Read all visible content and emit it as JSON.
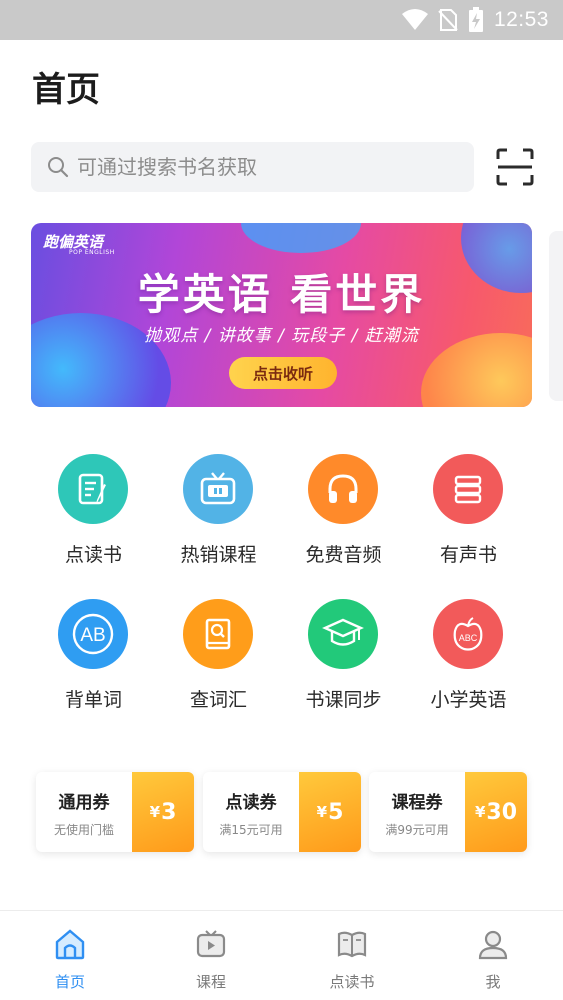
{
  "status_bar": {
    "time": "12:53",
    "icons": [
      "wifi-icon",
      "no-sim-icon",
      "battery-charging-icon"
    ]
  },
  "header": {
    "title": "首页"
  },
  "search": {
    "placeholder": "可通过搜索书名获取",
    "scan_icon": "scan-icon"
  },
  "banner": {
    "logo": "跑偏英语",
    "logo_sub": "POP ENGLISH",
    "headline": "学英语 看世界",
    "subline": "抛观点 / 讲故事 / 玩段子 / 赶潮流",
    "cta": "点击收听"
  },
  "features": [
    {
      "label": "点读书",
      "icon": "notebook-pen-icon",
      "color": "#2ec7b8"
    },
    {
      "label": "热销课程",
      "icon": "tv-icon",
      "color": "#52b3e6"
    },
    {
      "label": "免费音频",
      "icon": "headphones-icon",
      "color": "#ff8a2a"
    },
    {
      "label": "有声书",
      "icon": "book-stack-icon",
      "color": "#f25a5a"
    },
    {
      "label": "背单词",
      "icon": "ab-letters-icon",
      "color": "#2f9df2"
    },
    {
      "label": "查词汇",
      "icon": "dictionary-search-icon",
      "color": "#ff9d1a"
    },
    {
      "label": "书课同步",
      "icon": "graduation-cap-icon",
      "color": "#22c97a"
    },
    {
      "label": "小学英语",
      "icon": "apple-abc-icon",
      "color": "#f25a5a"
    }
  ],
  "coupons": [
    {
      "title": "通用券",
      "desc": "无使用门槛",
      "currency": "¥",
      "amount": "3"
    },
    {
      "title": "点读券",
      "desc": "满15元可用",
      "currency": "¥",
      "amount": "5"
    },
    {
      "title": "课程券",
      "desc": "满99元可用",
      "currency": "¥",
      "amount": "30"
    }
  ],
  "tab_bar": {
    "active": "首页",
    "accent_color": "#2f8ff2",
    "tabs": [
      {
        "label": "首页",
        "icon": "home-icon"
      },
      {
        "label": "课程",
        "icon": "tv-play-icon"
      },
      {
        "label": "点读书",
        "icon": "open-book-icon"
      },
      {
        "label": "我",
        "icon": "user-icon"
      }
    ]
  }
}
